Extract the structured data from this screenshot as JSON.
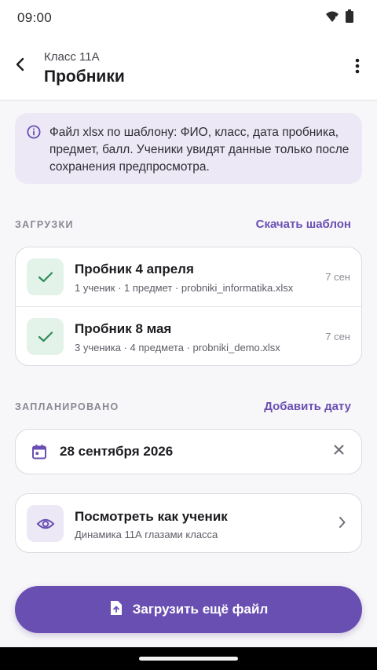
{
  "status_bar": {
    "time": "09:00",
    "icons": [
      "wifi-icon",
      "battery-icon"
    ]
  },
  "app_bar": {
    "subtitle": "Класс 11А",
    "title": "Пробники",
    "back_icon": "arrow-back-icon",
    "menu_icon": "more-vert-icon"
  },
  "info_banner": {
    "icon": "info-icon",
    "text": "Файл xlsx по шаблону: ФИО, класс, дата пробника, предмет, балл. Ученики увидят данные только после сохранения предпросмотра."
  },
  "uploads": {
    "label": "ЗАГРУЗКИ",
    "action": "Скачать шаблон",
    "items": [
      {
        "title": "Пробник 4 апреля",
        "subtitle": "1 ученик · 1 предмет · probniki_informatika.xlsx",
        "date": "7 сен",
        "icon": "check-icon"
      },
      {
        "title": "Пробник 8 мая",
        "subtitle": "3 ученика · 4 предмета · probniki_demo.xlsx",
        "date": "7 сен",
        "icon": "check-icon"
      }
    ]
  },
  "scheduled": {
    "label": "ЗАПЛАНИРОВАНО",
    "action": "Добавить дату",
    "date": "28 сентября 2026",
    "date_icon": "calendar-icon",
    "clear_icon": "close-icon"
  },
  "student_view": {
    "title": "Посмотреть как ученик",
    "subtitle": "Динамика 11А глазами класса",
    "icon": "eye-icon",
    "chevron_icon": "chevron-right-icon"
  },
  "upload_button": {
    "label": "Загрузить ещё файл",
    "icon": "file-upload-icon"
  },
  "colors": {
    "accent": "#6a4fb3",
    "success": "#2e8b57",
    "banner_bg": "#ece8f5",
    "success_bg": "#e4f3ea"
  }
}
